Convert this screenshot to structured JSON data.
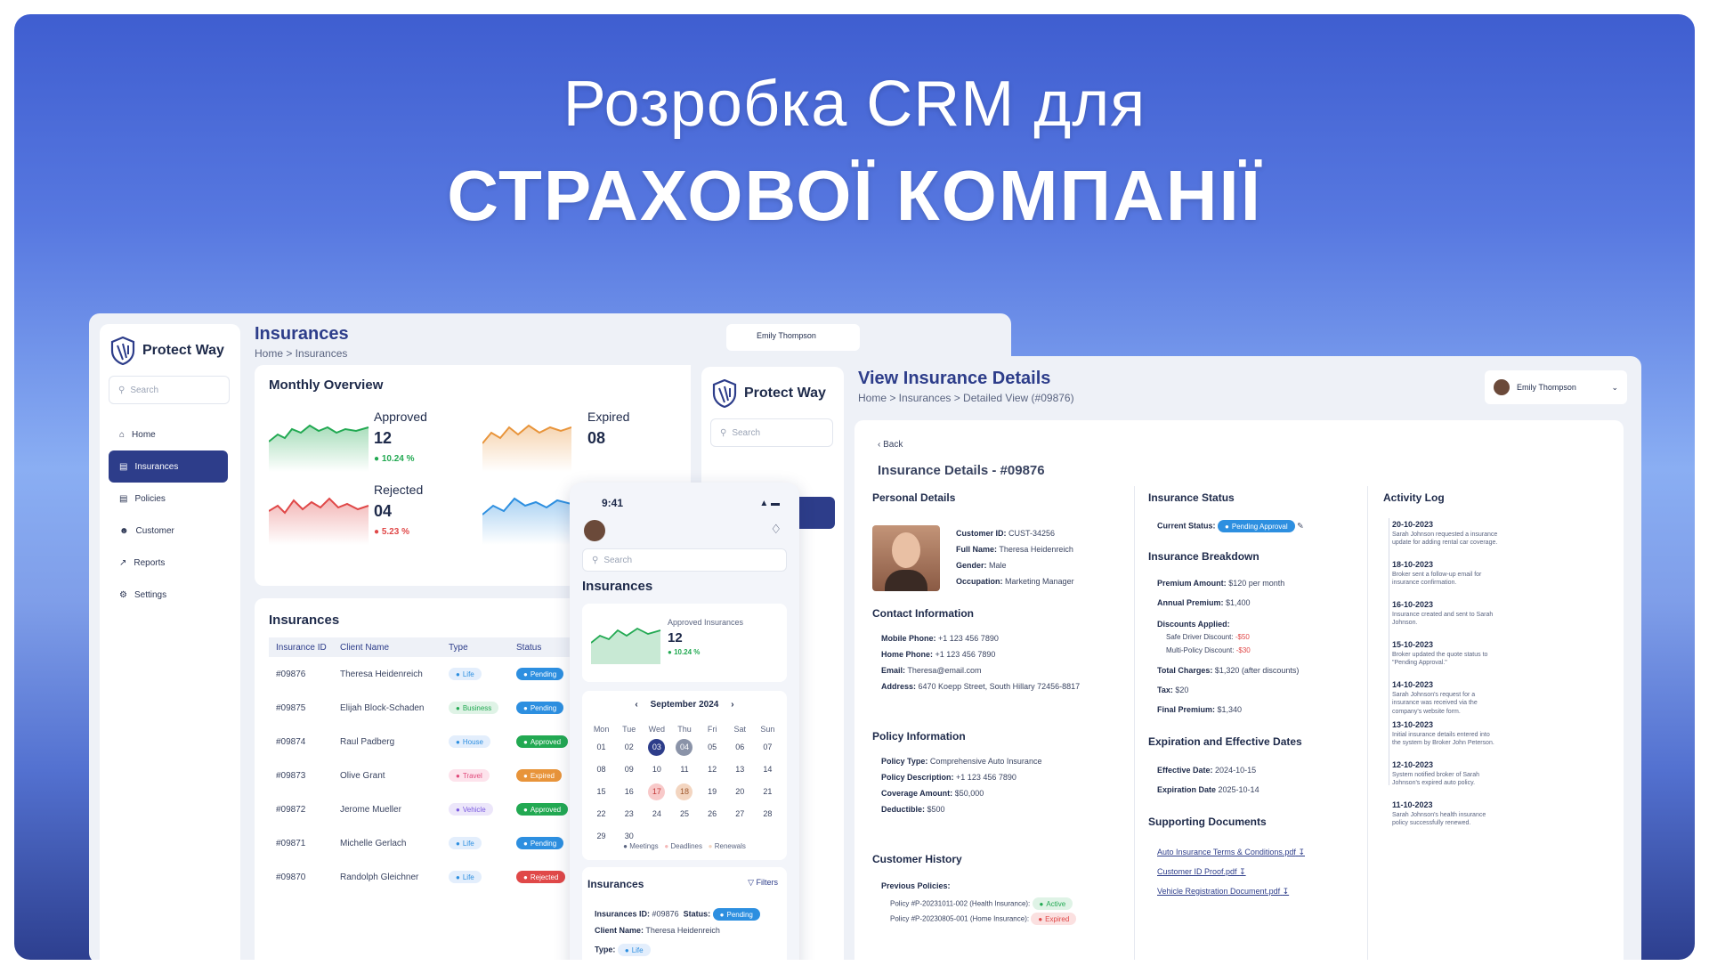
{
  "headline": {
    "line1": "Розробка CRM для",
    "line2": "СТРАХОВОЇ КОМПАНІЇ"
  },
  "colors": {
    "primary": "#2d3d8a",
    "approved": "#22a952",
    "rejected": "#e04848",
    "expired": "#e8943a",
    "pending": "#2d8fe0"
  },
  "brand": "Protect Way",
  "user": "Emily Thompson",
  "search_placeholder": "Search",
  "sidebar": {
    "items": [
      {
        "label": "Home",
        "icon": "home-icon"
      },
      {
        "label": "Insurances",
        "icon": "document-icon"
      },
      {
        "label": "Policies",
        "icon": "policy-icon"
      },
      {
        "label": "Customer",
        "icon": "customer-icon"
      },
      {
        "label": "Reports",
        "icon": "chart-icon"
      },
      {
        "label": "Settings",
        "icon": "gear-icon"
      }
    ]
  },
  "insurances_page": {
    "title": "Insurances",
    "breadcrumb": "Home > Insurances",
    "overview_title": "Monthly Overview",
    "stats": [
      {
        "label": "Approved",
        "value": "12",
        "change": "10.24 %"
      },
      {
        "label": "Rejected",
        "value": "04",
        "change": "5.23 %"
      },
      {
        "label": "Expired",
        "value": "08",
        "change": ""
      }
    ],
    "table_title": "Insurances",
    "columns": [
      "Insurance ID",
      "Client Name",
      "Type",
      "Status"
    ],
    "rows": [
      {
        "id": "#09876",
        "client": "Theresa Heidenreich",
        "type": "Life",
        "status": "Pending"
      },
      {
        "id": "#09875",
        "client": "Elijah Block-Schaden",
        "type": "Business",
        "status": "Pending"
      },
      {
        "id": "#09874",
        "client": "Raul Padberg",
        "type": "House",
        "status": "Approved"
      },
      {
        "id": "#09873",
        "client": "Olive Grant",
        "type": "Travel",
        "status": "Expired"
      },
      {
        "id": "#09872",
        "client": "Jerome Mueller",
        "type": "Vehicle",
        "status": "Approved"
      },
      {
        "id": "#09871",
        "client": "Michelle Gerlach",
        "type": "Life",
        "status": "Pending"
      },
      {
        "id": "#09870",
        "client": "Randolph Gleichner",
        "type": "Life",
        "status": "Rejected"
      }
    ]
  },
  "details_page": {
    "title": "View Insurance Details",
    "breadcrumb": "Home > Insurances > Detailed View (#09876)",
    "back": "Back",
    "heading": "Insurance Details - #09876",
    "personal": {
      "title": "Personal Details",
      "fields": [
        {
          "k": "Customer ID:",
          "v": "CUST-34256"
        },
        {
          "k": "Full Name:",
          "v": "Theresa Heidenreich"
        },
        {
          "k": "Gender:",
          "v": "Male"
        },
        {
          "k": "Occupation:",
          "v": "Marketing Manager"
        }
      ]
    },
    "contact": {
      "title": "Contact Information",
      "fields": [
        {
          "k": "Mobile Phone:",
          "v": "+1 123 456 7890"
        },
        {
          "k": "Home Phone:",
          "v": "+1 123 456 7890"
        },
        {
          "k": "Email:",
          "v": "Theresa@email.com"
        },
        {
          "k": "Address:",
          "v": "6470 Koepp Street, South Hillary 72456-8817"
        }
      ]
    },
    "policy": {
      "title": "Policy Information",
      "fields": [
        {
          "k": "Policy Type:",
          "v": "Comprehensive Auto Insurance"
        },
        {
          "k": "Policy Description:",
          "v": "+1 123 456 7890"
        },
        {
          "k": "Coverage Amount:",
          "v": "$50,000"
        },
        {
          "k": "Deductible:",
          "v": "$500"
        }
      ]
    },
    "history": {
      "title": "Customer History",
      "label": "Previous Policies:",
      "items": [
        {
          "text": "Policy #P-20231011-002 (Health Insurance):",
          "status": "Active"
        },
        {
          "text": "Policy #P-20230805-001 (Home Insurance):",
          "status": "Expired"
        }
      ]
    },
    "status": {
      "title": "Insurance Status",
      "label": "Current Status:",
      "value": "Pending Approval"
    },
    "breakdown": {
      "title": "Insurance Breakdown",
      "premium": {
        "k": "Premium Amount:",
        "v": "$120 per month"
      },
      "annual": {
        "k": "Annual Premium:",
        "v": "$1,400"
      },
      "discounts_label": "Discounts Applied:",
      "discounts": [
        {
          "k": "Safe Driver Discount:",
          "v": "-$50"
        },
        {
          "k": "Multi-Policy Discount:",
          "v": "-$30"
        }
      ],
      "total": {
        "k": "Total Charges:",
        "v": "$1,320 (after discounts)"
      },
      "tax": {
        "k": "Tax:",
        "v": "$20"
      },
      "final": {
        "k": "Final Premium:",
        "v": "$1,340"
      }
    },
    "dates": {
      "title": "Expiration and Effective Dates",
      "effective": {
        "k": "Effective Date:",
        "v": "2024-10-15"
      },
      "expiration": {
        "k": "Expiration Date",
        "v": "2025-10-14"
      }
    },
    "documents": {
      "title": "Supporting Documents",
      "items": [
        "Auto Insurance Terms & Conditions.pdf",
        "Customer ID Proof.pdf",
        "Vehicle Registration Document.pdf"
      ]
    },
    "activity": {
      "title": "Activity Log",
      "items": [
        {
          "date": "20-10-2023",
          "text": "Sarah Johnson requested a insurance update for adding rental car coverage."
        },
        {
          "date": "18-10-2023",
          "text": "Broker sent a follow-up email for insurance confirmation."
        },
        {
          "date": "16-10-2023",
          "text": "Insurance created and sent to Sarah Johnson."
        },
        {
          "date": "15-10-2023",
          "text": "Broker updated the quote status to \"Pending Approval.\""
        },
        {
          "date": "14-10-2023",
          "text": "Sarah Johnson's request for a insurance was received via the company's website form."
        },
        {
          "date": "13-10-2023",
          "text": "Initial insurance details entered into the system by Broker John Peterson."
        },
        {
          "date": "12-10-2023",
          "text": "System notified broker of Sarah Johnson's expired auto policy."
        },
        {
          "date": "11-10-2023",
          "text": "Sarah Johnson's health insurance policy successfully renewed."
        }
      ]
    }
  },
  "mobile": {
    "time": "9:41",
    "title": "Insurances",
    "card_label": "Approved Insurances",
    "card_value": "12",
    "card_change": "10.24 %",
    "month": "September 2024",
    "weekdays": [
      "Mon",
      "Tue",
      "Wed",
      "Thu",
      "Fri",
      "Sat",
      "Sun"
    ],
    "days": [
      "01",
      "02",
      "03",
      "04",
      "05",
      "06",
      "07",
      "08",
      "09",
      "10",
      "11",
      "12",
      "13",
      "14",
      "15",
      "16",
      "17",
      "18",
      "19",
      "20",
      "21",
      "22",
      "23",
      "24",
      "25",
      "26",
      "27",
      "28",
      "29",
      "30"
    ],
    "legend": [
      "Meetings",
      "Deadlines",
      "Renewals"
    ],
    "list_title": "Insurances",
    "filters": "Filters",
    "item": {
      "id_label": "Insurances ID:",
      "id": "#09876",
      "status_label": "Status:",
      "status": "Pending",
      "client_label": "Client Name:",
      "client": "Theresa Heidenreich",
      "type_label": "Type:",
      "type": "Life"
    }
  }
}
